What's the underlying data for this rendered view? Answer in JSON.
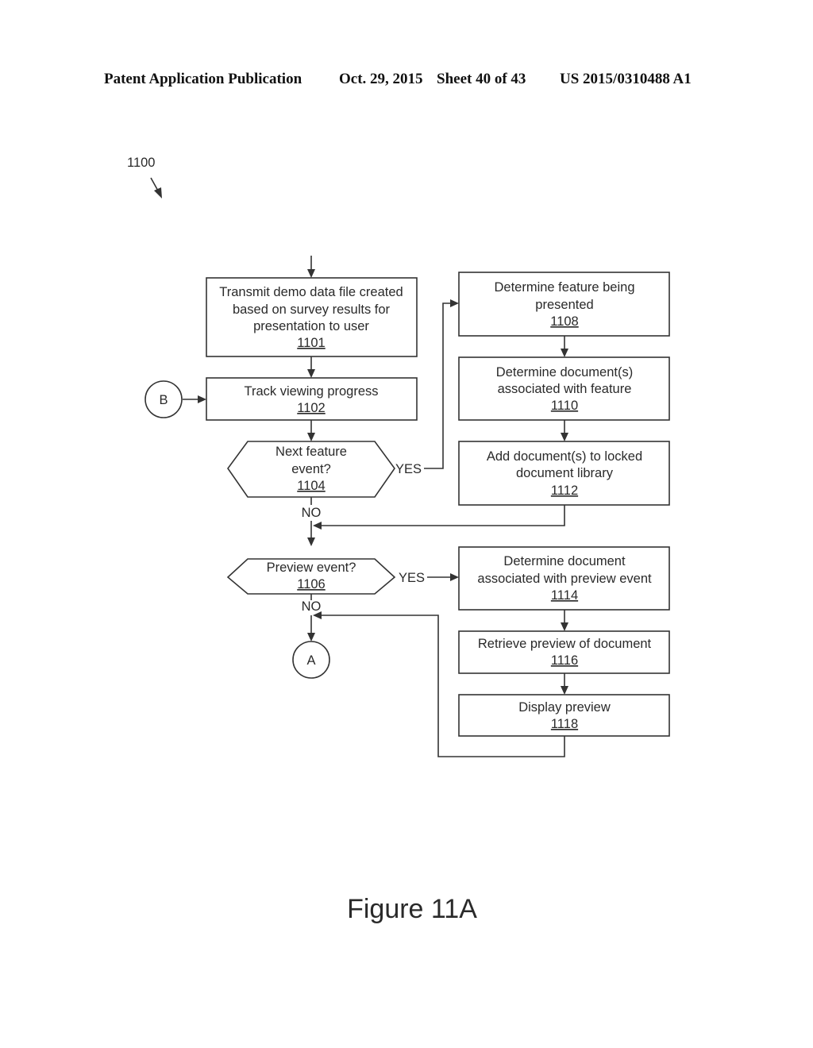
{
  "header": {
    "publication": "Patent Application Publication",
    "date": "Oct. 29, 2015",
    "sheet": "Sheet 40 of 43",
    "number": "US 2015/0310488 A1"
  },
  "diagram": {
    "ref_label": "1100",
    "figure_caption": "Figure 11A",
    "steps": {
      "s1101": {
        "lines": [
          "Transmit demo data file created",
          "based on survey results for",
          "presentation to user"
        ],
        "ref": "1101"
      },
      "s1102": {
        "lines": [
          "Track viewing progress"
        ],
        "ref": "1102"
      },
      "s1104": {
        "lines": [
          "Next feature",
          "event?"
        ],
        "ref": "1104"
      },
      "s1106": {
        "lines": [
          "Preview event?"
        ],
        "ref": "1106"
      },
      "s1108": {
        "lines": [
          "Determine feature being",
          "presented"
        ],
        "ref": "1108"
      },
      "s1110": {
        "lines": [
          "Determine document(s)",
          "associated with feature"
        ],
        "ref": "1110"
      },
      "s1112": {
        "lines": [
          "Add document(s) to locked",
          "document library"
        ],
        "ref": "1112"
      },
      "s1114": {
        "lines": [
          "Determine document",
          "associated with preview event"
        ],
        "ref": "1114"
      },
      "s1116": {
        "lines": [
          "Retrieve preview of document"
        ],
        "ref": "1116"
      },
      "s1118": {
        "lines": [
          "Display preview"
        ],
        "ref": "1118"
      }
    },
    "connectors": {
      "a": "A",
      "b": "B"
    },
    "branch_labels": {
      "yes1": "YES",
      "no1": "NO",
      "yes2": "YES",
      "no2": "NO"
    }
  }
}
